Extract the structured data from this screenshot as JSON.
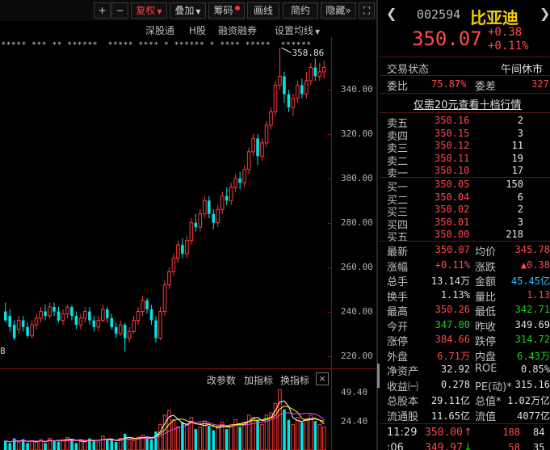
{
  "toolbar": {
    "plus": "+",
    "minus": "−",
    "adjust": "复权",
    "overlay": "叠加",
    "chips": "筹码",
    "draw": "画线",
    "simple": "简约",
    "hide": "隐藏",
    "collapse": "»",
    "fullscreen": "⛶"
  },
  "subtabs": {
    "sz_connect": "深股通",
    "h_share": "H股",
    "margin": "融资融券",
    "ma_settings": "设置均线"
  },
  "chart_data": {
    "type": "candlestick",
    "high_label": "358.86",
    "low_label": "8",
    "y_ticks": [
      "340.00",
      "320.00",
      "300.00",
      "280.00",
      "260.00",
      "240.00",
      "220.00"
    ],
    "ylim": [
      218,
      360
    ],
    "volume_ticks": [
      "49.40",
      "24.40"
    ],
    "volume_ylim": [
      0,
      55
    ],
    "candles": [
      [
        240,
        236,
        244,
        235
      ],
      [
        238,
        233,
        241,
        231
      ],
      [
        234,
        228,
        236,
        227
      ],
      [
        232,
        236,
        238,
        230
      ],
      [
        236,
        233,
        238,
        231
      ],
      [
        233,
        229,
        235,
        228
      ],
      [
        229,
        234,
        236,
        228
      ],
      [
        234,
        237,
        239,
        232
      ],
      [
        237,
        240,
        242,
        235
      ],
      [
        240,
        238,
        243,
        236
      ],
      [
        238,
        242,
        244,
        237
      ],
      [
        242,
        240,
        244,
        238
      ],
      [
        240,
        236,
        242,
        235
      ],
      [
        236,
        239,
        241,
        234
      ],
      [
        239,
        242,
        243,
        237
      ],
      [
        242,
        238,
        243,
        236
      ],
      [
        238,
        234,
        240,
        232
      ],
      [
        234,
        237,
        239,
        232
      ],
      [
        237,
        240,
        242,
        235
      ],
      [
        240,
        236,
        242,
        234
      ],
      [
        236,
        233,
        238,
        231
      ],
      [
        233,
        236,
        238,
        231
      ],
      [
        236,
        241,
        243,
        235
      ],
      [
        241,
        237,
        242,
        235
      ],
      [
        237,
        233,
        239,
        232
      ],
      [
        233,
        230,
        235,
        228
      ],
      [
        230,
        234,
        236,
        229
      ],
      [
        234,
        228,
        235,
        222
      ],
      [
        228,
        231,
        233,
        226
      ],
      [
        231,
        236,
        238,
        230
      ],
      [
        236,
        240,
        242,
        234
      ],
      [
        240,
        245,
        247,
        238
      ],
      [
        245,
        241,
        246,
        239
      ],
      [
        241,
        236,
        243,
        234
      ],
      [
        236,
        228,
        238,
        226
      ],
      [
        228,
        240,
        242,
        227
      ],
      [
        240,
        252,
        254,
        238
      ],
      [
        252,
        258,
        260,
        250
      ],
      [
        258,
        264,
        266,
        256
      ],
      [
        264,
        270,
        272,
        262
      ],
      [
        270,
        266,
        273,
        264
      ],
      [
        266,
        272,
        274,
        264
      ],
      [
        272,
        280,
        282,
        270
      ],
      [
        280,
        278,
        284,
        276
      ],
      [
        278,
        284,
        286,
        276
      ],
      [
        284,
        290,
        292,
        282
      ],
      [
        290,
        284,
        292,
        282
      ],
      [
        284,
        280,
        286,
        277
      ],
      [
        280,
        286,
        288,
        278
      ],
      [
        286,
        292,
        294,
        284
      ],
      [
        292,
        290,
        296,
        288
      ],
      [
        290,
        296,
        298,
        288
      ],
      [
        296,
        300,
        302,
        294
      ],
      [
        300,
        298,
        303,
        295
      ],
      [
        298,
        304,
        306,
        296
      ],
      [
        304,
        312,
        314,
        302
      ],
      [
        312,
        318,
        320,
        310
      ],
      [
        318,
        310,
        320,
        306
      ],
      [
        310,
        316,
        318,
        308
      ],
      [
        316,
        324,
        326,
        314
      ],
      [
        324,
        330,
        332,
        322
      ],
      [
        330,
        342,
        344,
        328
      ],
      [
        342,
        346,
        358.86,
        340
      ],
      [
        346,
        338,
        348,
        334
      ],
      [
        338,
        332,
        340,
        330
      ],
      [
        332,
        336,
        338,
        328
      ],
      [
        336,
        342,
        344,
        334
      ],
      [
        342,
        338,
        345,
        336
      ],
      [
        338,
        344,
        348,
        336
      ],
      [
        344,
        350,
        352,
        342
      ],
      [
        350,
        346,
        354,
        344
      ],
      [
        346,
        348,
        352,
        344
      ],
      [
        348,
        350,
        353,
        345
      ]
    ],
    "volumes": [
      8,
      6,
      10,
      7,
      9,
      6,
      8,
      7,
      9,
      6,
      10,
      8,
      7,
      9,
      11,
      8,
      6,
      9,
      7,
      10,
      8,
      7,
      12,
      9,
      8,
      7,
      10,
      14,
      9,
      8,
      11,
      13,
      10,
      9,
      16,
      22,
      30,
      34,
      26,
      20,
      24,
      22,
      28,
      18,
      20,
      25,
      21,
      17,
      19,
      24,
      18,
      22,
      26,
      20,
      24,
      30,
      28,
      26,
      22,
      30,
      32,
      40,
      52,
      35,
      26,
      22,
      28,
      24,
      27,
      30,
      25,
      22,
      20
    ],
    "ma_lines": [
      "#ffffff",
      "#ffff00",
      "#ff40ff"
    ]
  },
  "indicators": {
    "modify": "改参数",
    "add": "加指标",
    "switch": "换指标",
    "close": "×"
  },
  "quote": {
    "code": "002594",
    "name": "比亚迪",
    "price": "350.07",
    "change": "+0.38",
    "change_pct": "+0.11%",
    "status_label": "交易状态",
    "status_value": "午间休市",
    "weibi_label": "委比",
    "weibi_value": "75.87%",
    "weicha_label": "委差",
    "weicha_value": "327",
    "depth_link": "仅需20元查看十档行情",
    "asks": [
      {
        "label": "卖五",
        "price": "350.16",
        "vol": "2"
      },
      {
        "label": "卖四",
        "price": "350.15",
        "vol": "3"
      },
      {
        "label": "卖三",
        "price": "350.12",
        "vol": "11"
      },
      {
        "label": "卖二",
        "price": "350.11",
        "vol": "19"
      },
      {
        "label": "卖一",
        "price": "350.10",
        "vol": "17"
      }
    ],
    "bids": [
      {
        "label": "买一",
        "price": "350.05",
        "vol": "150"
      },
      {
        "label": "买二",
        "price": "350.04",
        "vol": "6"
      },
      {
        "label": "买三",
        "price": "350.02",
        "vol": "2"
      },
      {
        "label": "买四",
        "price": "350.01",
        "vol": "3"
      },
      {
        "label": "买五",
        "price": "350.00",
        "vol": "218"
      }
    ],
    "stats": [
      {
        "l1": "最新",
        "v1": "350.07",
        "c1": "r",
        "l2": "均价",
        "v2": "345.78",
        "c2": "r"
      },
      {
        "l1": "涨幅",
        "v1": "+0.11%",
        "c1": "r",
        "l2": "涨跌",
        "v2": "▲0.38",
        "c2": "r"
      },
      {
        "l1": "总手",
        "v1": "13.14万",
        "c1": "w",
        "l2": "金额",
        "v2": "45.45亿",
        "c2": "c"
      },
      {
        "l1": "换手",
        "v1": "1.13%",
        "c1": "w",
        "l2": "量比",
        "v2": "1.13",
        "c2": "r"
      },
      {
        "l1": "最高",
        "v1": "350.26",
        "c1": "r",
        "l2": "最低",
        "v2": "342.71",
        "c2": "g"
      },
      {
        "l1": "今开",
        "v1": "347.00",
        "c1": "g",
        "l2": "昨收",
        "v2": "349.69",
        "c2": "w"
      },
      {
        "l1": "涨停",
        "v1": "384.66",
        "c1": "r",
        "l2": "跌停",
        "v2": "314.72",
        "c2": "g"
      },
      {
        "l1": "外盘",
        "v1": "6.71万",
        "c1": "r",
        "l2": "内盘",
        "v2": "6.43万",
        "c2": "g"
      },
      {
        "l1": "净资产",
        "v1": "32.92",
        "c1": "w",
        "l2": "ROE",
        "v2": "0.85%",
        "c2": "w"
      },
      {
        "l1": "收益㈠",
        "v1": "0.278",
        "c1": "w",
        "l2": "PE(动)*",
        "v2": "315.16",
        "c2": "w"
      },
      {
        "l1": "总股本",
        "v1": "29.11亿",
        "c1": "w",
        "l2": "总值*",
        "v2": "1.02万亿",
        "c2": "w"
      },
      {
        "l1": "流通股",
        "v1": "11.65亿",
        "c1": "w",
        "l2": "流值",
        "v2": "4077亿",
        "c2": "w"
      }
    ],
    "ticks": [
      {
        "time": "11:29",
        "price": "350.00",
        "arrow": "↑",
        "vol": "188",
        "num": "84"
      },
      {
        "time": ":06",
        "price": "349.97",
        "arrow": "↓",
        "vol": "58",
        "num": "35"
      }
    ]
  },
  "colors": {
    "up": "#ff3a3a",
    "down": "#00e5e5",
    "axis": "#8a1010",
    "price_red": "#ff4a4a",
    "price_green": "#19d219",
    "amount_cyan": "#2cc2ff",
    "title_yellow": "#f5d000"
  }
}
